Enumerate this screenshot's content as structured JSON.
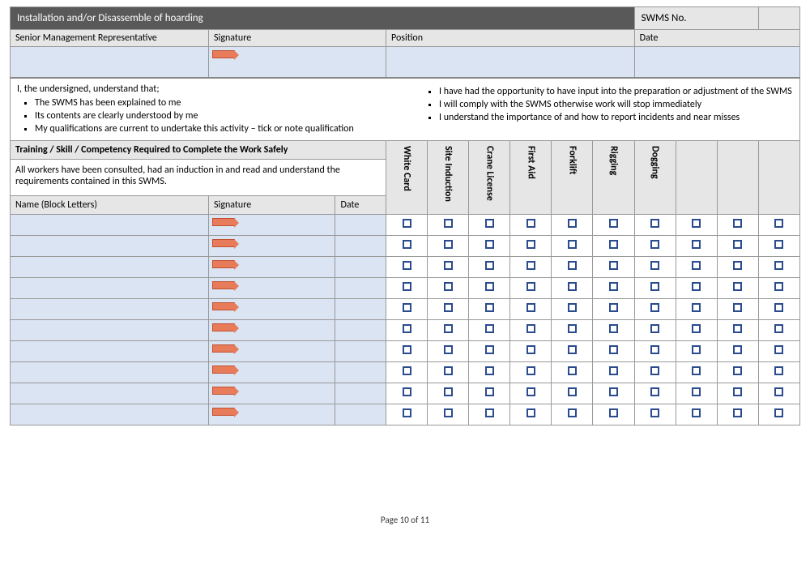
{
  "title": "Installation and/or Disassemble of hoarding",
  "swms_no_label": "SWMS No.",
  "headers": {
    "senior_rep": "Senior Management Representative",
    "signature": "Signature",
    "position": "Position",
    "date": "Date"
  },
  "declaration": {
    "intro": "I, the undersigned, understand that;",
    "left": [
      "The SWMS has been explained to me",
      "Its contents are clearly understood by me",
      "My qualifications are current to undertake this activity – tick or note qualification"
    ],
    "right": [
      "I have had the opportunity to have input into the preparation or adjustment of the SWMS",
      "I will comply with the SWMS otherwise work will stop immediately",
      "I understand the importance of and how to report incidents and near misses"
    ]
  },
  "training_header": "Training / Skill / Competency Required to Complete the Work Safely",
  "training_note": "All workers have been consulted, had an induction in and read and understand the requirements contained in this SWMS.",
  "col_headers": {
    "name": "Name (Block Letters)",
    "signature": "Signature",
    "date": "Date"
  },
  "skills": [
    "White Card",
    "Site Induction",
    "Crane License",
    "First Aid",
    "Forklift",
    "Rigging",
    "Dogging",
    "",
    "",
    ""
  ],
  "row_count": 10,
  "footer": "Page 10 of 11"
}
